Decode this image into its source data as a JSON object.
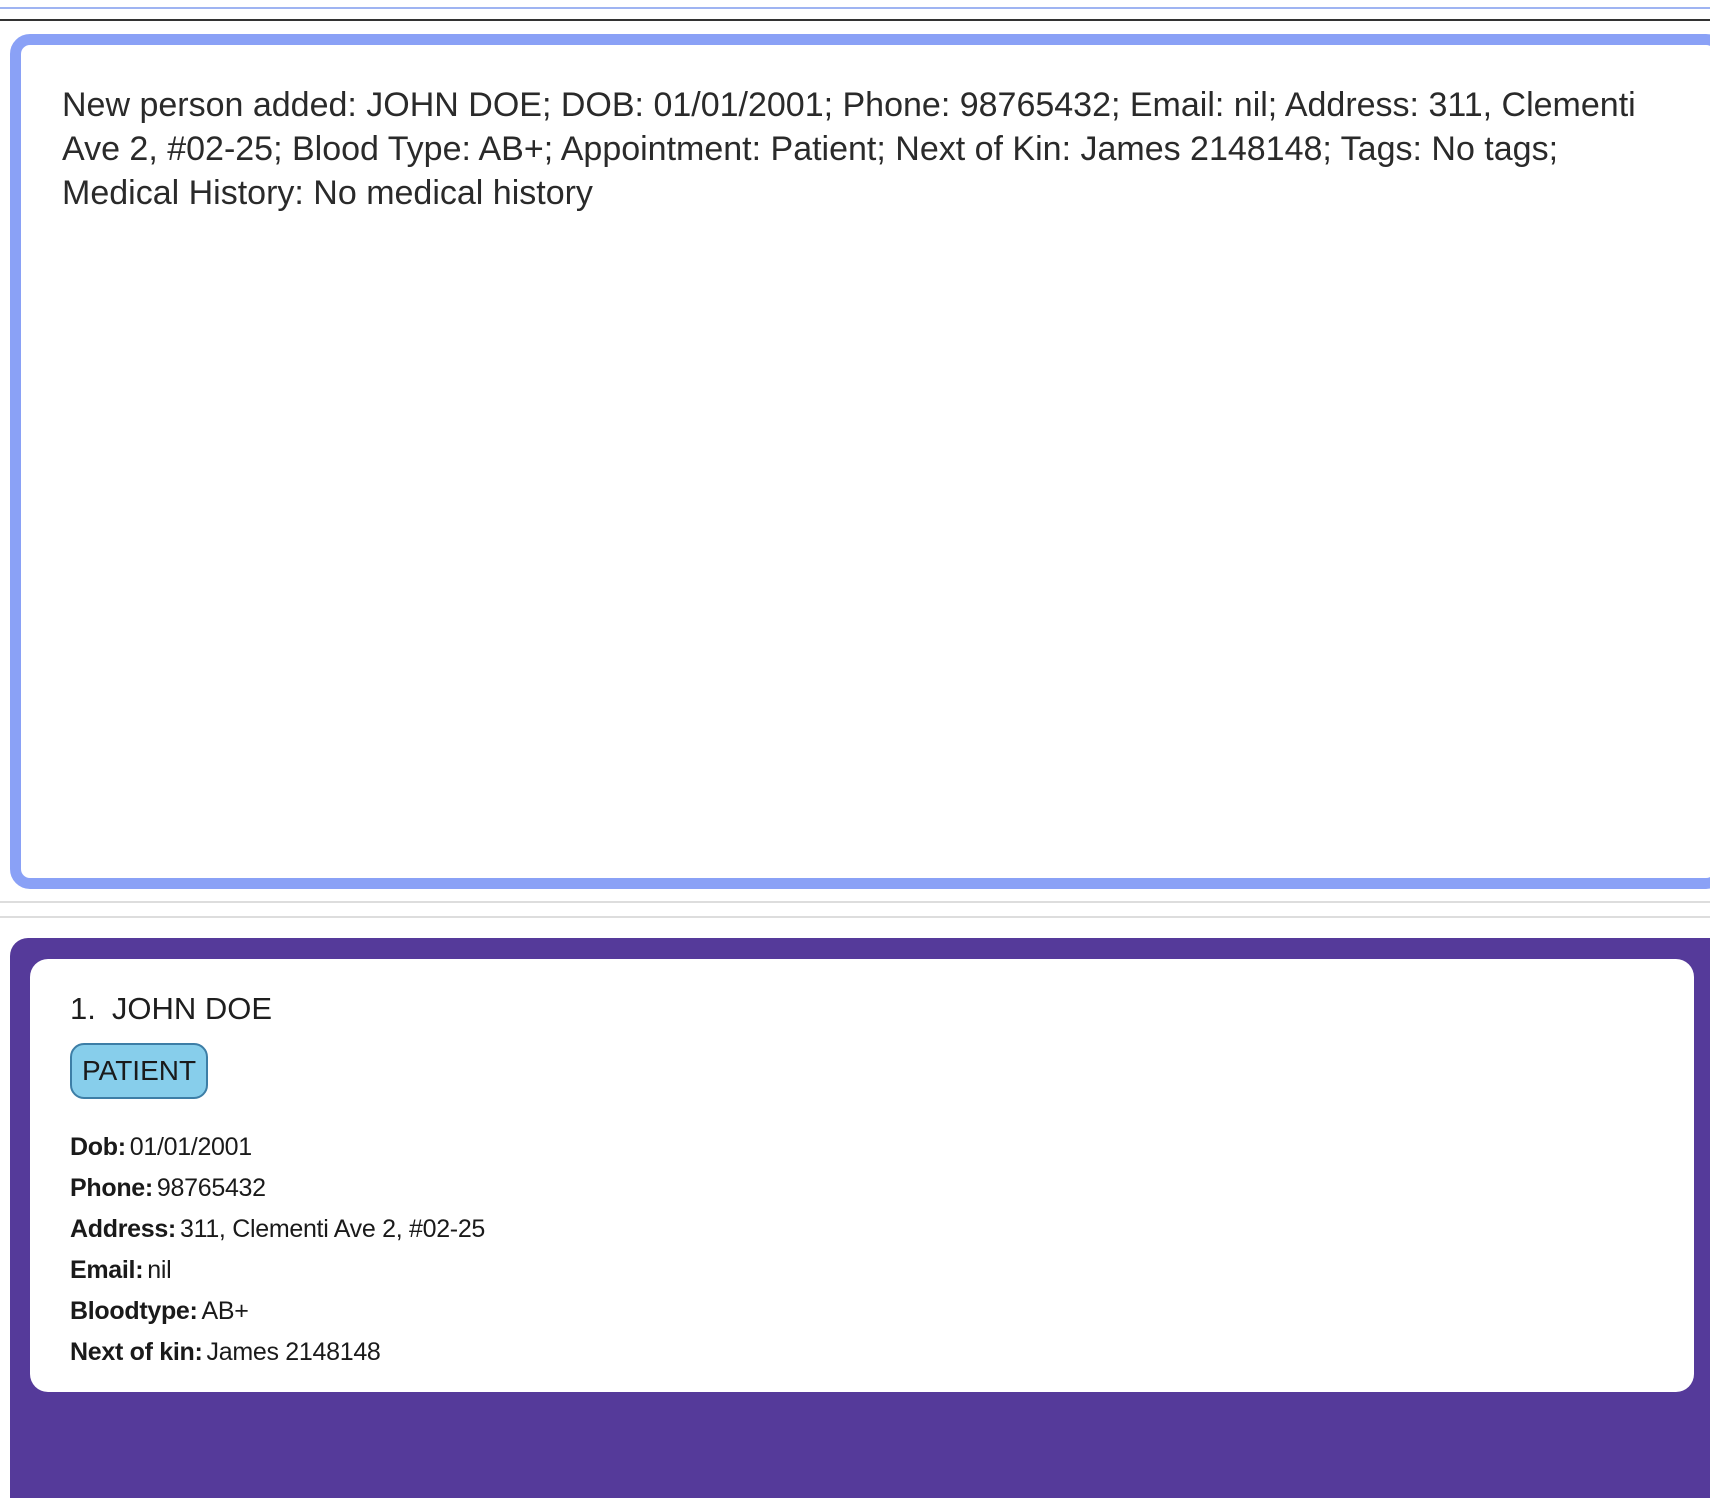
{
  "result_display": {
    "message": "New person added: JOHN DOE; DOB: 01/01/2001; Phone: 98765432; Email: nil; Address: 311, Clementi Ave 2, #02-25; Blood Type: AB+; Appointment: Patient; Next of Kin: James 2148148; Tags: No tags; Medical History: No medical history"
  },
  "person_list": {
    "cards": [
      {
        "index": "1.",
        "name": "JOHN DOE",
        "tag": "PATIENT",
        "fields": {
          "dob_label": "Dob:",
          "dob": "01/01/2001",
          "phone_label": "Phone:",
          "phone": "98765432",
          "address_label": "Address:",
          "address": "311, Clementi Ave 2, #02-25",
          "email_label": "Email:",
          "email": "nil",
          "bloodtype_label": "Bloodtype:",
          "bloodtype": "AB+",
          "nok_label": "Next of kin:",
          "nok": "James 2148148"
        }
      }
    ]
  },
  "colors": {
    "result_border": "#8aa1f6",
    "list_background": "#553a9a",
    "tag_background": "#87ceeb",
    "tag_border": "#3d7ea6"
  }
}
